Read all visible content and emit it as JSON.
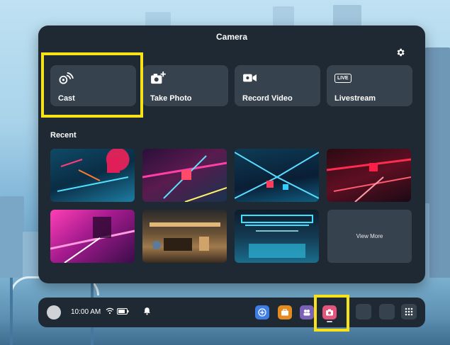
{
  "panel": {
    "title": "Camera",
    "actions": [
      {
        "label": "Cast",
        "icon": "cast-icon"
      },
      {
        "label": "Take Photo",
        "icon": "add-photo-icon"
      },
      {
        "label": "Record Video",
        "icon": "video-camera-icon"
      },
      {
        "label": "Livestream",
        "icon": "live-badge-icon",
        "badge": "LIVE"
      }
    ],
    "recent_label": "Recent",
    "view_more_label": "View More"
  },
  "taskbar": {
    "time": "10:00 AM",
    "apps": [
      {
        "icon": "store-icon",
        "color": "#3f7de6"
      },
      {
        "icon": "briefcase-icon",
        "color": "#e58a1f"
      },
      {
        "icon": "people-icon",
        "color": "#7b62b8"
      },
      {
        "icon": "camera-icon",
        "color": "#e2567c"
      }
    ]
  },
  "colors": {
    "panel": "#1f2934",
    "tile": "#37424f",
    "highlight": "#f7e21a"
  }
}
